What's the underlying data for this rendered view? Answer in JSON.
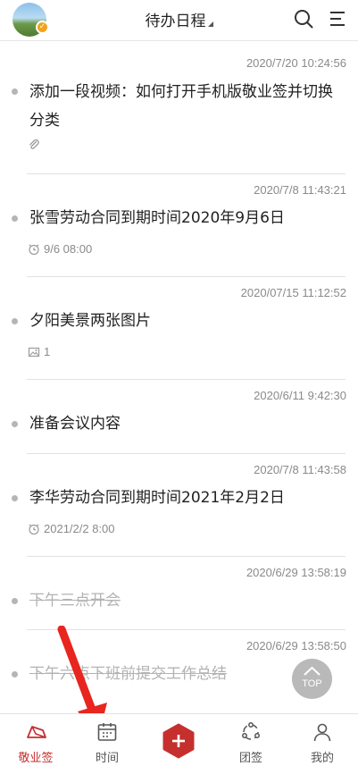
{
  "header": {
    "title": "待办日程",
    "avatar_badge_icon": "check-badge-icon"
  },
  "items": [
    {
      "timestamp": "2020/7/20 10:24:56",
      "title": "添加一段视频：如何打开手机版敬业签并切换分类",
      "meta_icon": "paperclip-icon",
      "meta_text": "",
      "done": false
    },
    {
      "timestamp": "2020/7/8 11:43:21",
      "title": "张雪劳动合同到期时间2020年9月6日",
      "meta_icon": "alarm-clock-icon",
      "meta_text": "9/6 08:00",
      "done": false
    },
    {
      "timestamp": "2020/07/15 11:12:52",
      "title": "夕阳美景两张图片",
      "meta_icon": "image-icon",
      "meta_text": "1",
      "done": false
    },
    {
      "timestamp": "2020/6/11 9:42:30",
      "title": "准备会议内容",
      "meta_icon": "",
      "meta_text": "",
      "done": false
    },
    {
      "timestamp": "2020/7/8 11:43:58",
      "title": "李华劳动合同到期时间2021年2月2日",
      "meta_icon": "alarm-clock-icon",
      "meta_text": "2021/2/2 8:00",
      "done": false
    },
    {
      "timestamp": "2020/6/29 13:58:19",
      "title": "下午三点开会",
      "meta_icon": "",
      "meta_text": "",
      "done": true
    },
    {
      "timestamp": "2020/6/29 13:58:50",
      "title": "下午六点下班前提交工作总结",
      "meta_icon": "",
      "meta_text": "",
      "done": true
    }
  ],
  "top_button": {
    "label": "TOP"
  },
  "tabbar": {
    "tabs": [
      {
        "label": "敬业签",
        "icon": "memo-tab-icon",
        "active": true
      },
      {
        "label": "时间",
        "icon": "calendar-icon",
        "active": false
      },
      {
        "label": "",
        "icon": "add-icon",
        "active": false
      },
      {
        "label": "团签",
        "icon": "team-icon",
        "active": false
      },
      {
        "label": "我的",
        "icon": "user-icon",
        "active": false
      }
    ]
  },
  "colors": {
    "accent": "#c5302f",
    "arrow": "#e8251f",
    "muted": "#8a8a8a"
  }
}
